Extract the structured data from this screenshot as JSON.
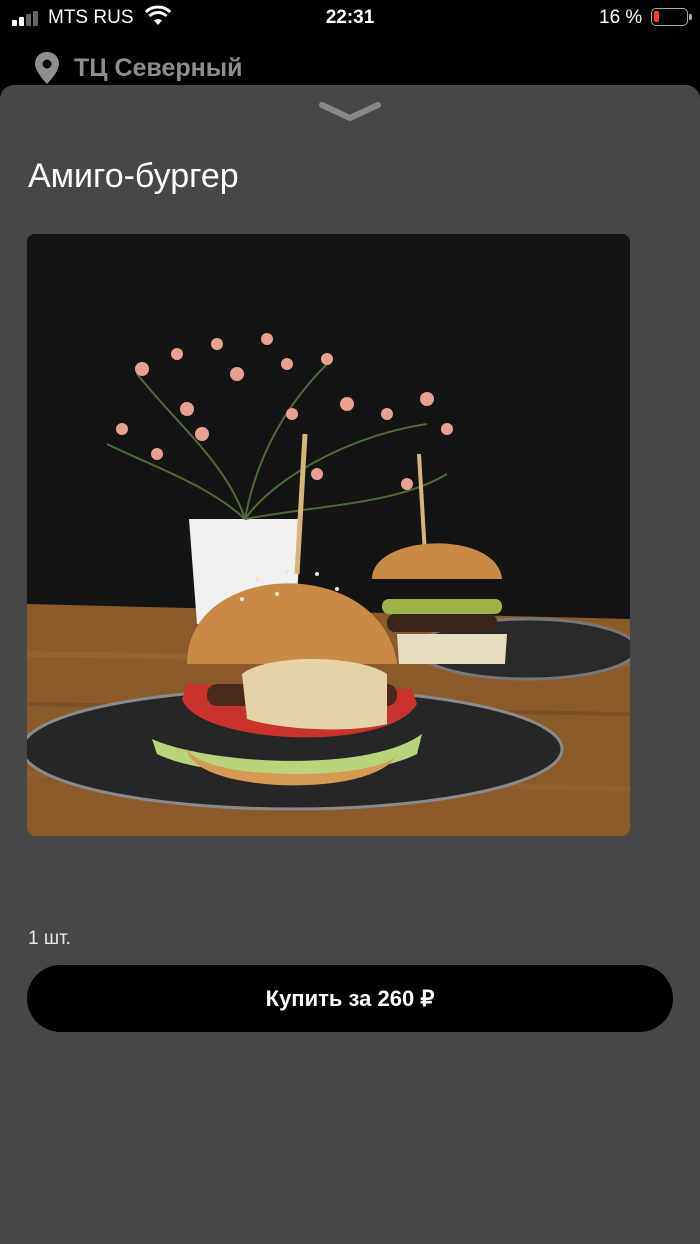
{
  "status_bar": {
    "carrier": "MTS RUS",
    "time": "22:31",
    "battery_percent": "16 %",
    "battery_level": 0.16
  },
  "location": {
    "name": "ТЦ Северный",
    "icon": "location-pin-icon"
  },
  "product": {
    "title": "Амиго-бургер",
    "image_alt": "Амиго-бургер",
    "quantity": "1 шт.",
    "buy_label": "Купить за 260 ₽"
  },
  "colors": {
    "background": "#000000",
    "sheet": "#474747",
    "button": "#000000",
    "location_text": "#8e8e8e",
    "battery_low": "#ff3b30"
  }
}
